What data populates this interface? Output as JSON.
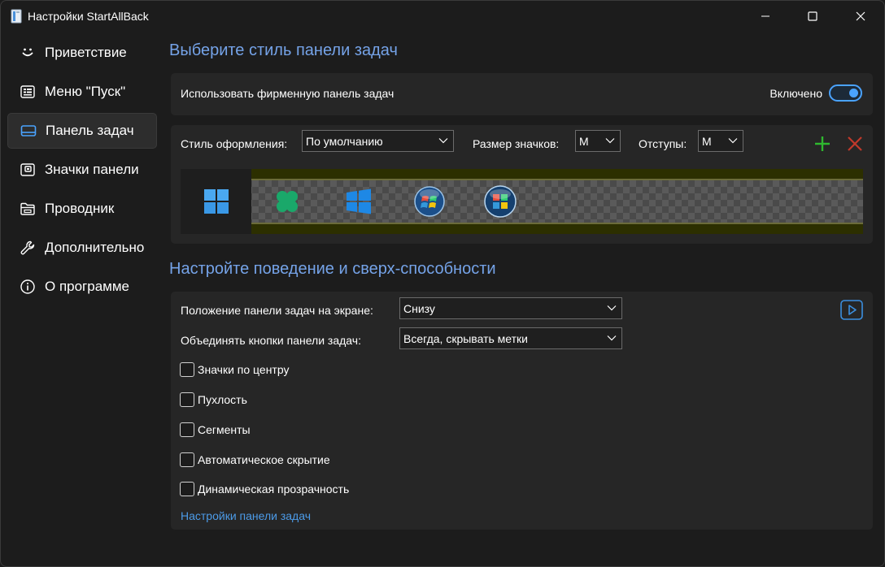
{
  "window": {
    "title": "Настройки StartAllBack",
    "controls": {
      "minimize": "minimize-icon",
      "maximize": "maximize-icon",
      "close": "close-icon"
    }
  },
  "sidebar": {
    "items": [
      {
        "label": "Приветствие",
        "icon": "smile-icon",
        "active": false
      },
      {
        "label": "Меню \"Пуск\"",
        "icon": "start-menu-icon",
        "active": false
      },
      {
        "label": "Панель задач",
        "icon": "taskbar-icon",
        "active": true
      },
      {
        "label": "Значки панели",
        "icon": "tray-icons-icon",
        "active": false
      },
      {
        "label": "Проводник",
        "icon": "folder-icon",
        "active": false
      },
      {
        "label": "Дополнительно",
        "icon": "wrench-icon",
        "active": false
      },
      {
        "label": "О программе",
        "icon": "info-icon",
        "active": false
      }
    ]
  },
  "style_section": {
    "title": "Выберите стиль панели задач",
    "enhanced_taskbar": {
      "label": "Использовать фирменную панель задач",
      "state": "Включено",
      "on": true
    },
    "theme_label": "Стиль оформления:",
    "theme_value": "По умолчанию",
    "icon_size_label": "Размер значков:",
    "icon_size_value": "M",
    "padding_label": "Отступы:",
    "padding_value": "M",
    "add_icon": "plus-icon",
    "remove_icon": "x-icon",
    "styles": [
      {
        "icon": "windows11-logo-icon",
        "selected": true
      },
      {
        "icon": "clover-logo-icon",
        "selected": false
      },
      {
        "icon": "windows10-logo-icon",
        "selected": false
      },
      {
        "icon": "windows7-orb-icon",
        "selected": false
      },
      {
        "icon": "windows7-orb-icon",
        "selected": false
      }
    ]
  },
  "behavior_section": {
    "title": "Настройте поведение и сверх-способности",
    "position_label": "Положение панели задач на экране:",
    "position_value": "Снизу",
    "combine_label": "Объединять кнопки панели задач:",
    "combine_value": "Всегда, скрывать метки",
    "play_icon": "play-icon",
    "checkboxes": [
      {
        "label": "Значки по центру",
        "checked": false
      },
      {
        "label": "Пухлость",
        "checked": false
      },
      {
        "label": "Сегменты",
        "checked": false
      },
      {
        "label": "Автоматическое скрытие",
        "checked": false
      },
      {
        "label": "Динамическая прозрачность",
        "checked": false
      }
    ],
    "link": "Настройки панели задач"
  },
  "colors": {
    "accent": "#4aa3ff",
    "heading": "#75a3e8",
    "link": "#4c9be8",
    "add": "#2fb82f",
    "remove": "#c0392b"
  }
}
